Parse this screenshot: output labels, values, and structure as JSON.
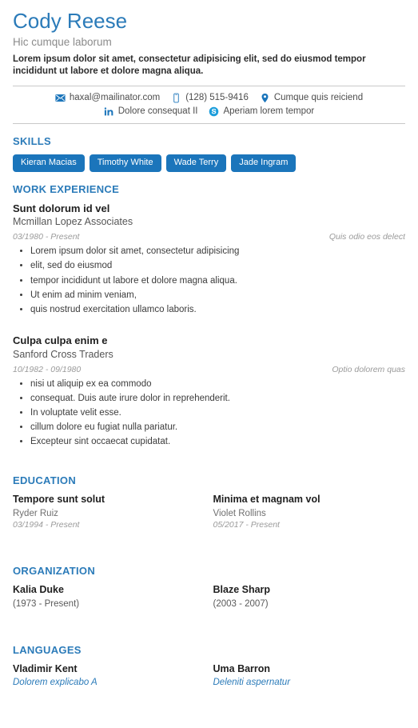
{
  "header": {
    "name": "Cody Reese",
    "subtitle": "Hic cumque laborum",
    "summary": "Lorem ipsum dolor sit amet, consectetur adipisicing elit, sed do eiusmod tempor incididunt ut labore et dolore magna aliqua."
  },
  "contact": {
    "row1": [
      {
        "icon": "envelope-icon",
        "text": "haxal@mailinator.com"
      },
      {
        "icon": "mobile-phone-icon",
        "text": "(128) 515-9416"
      },
      {
        "icon": "location-pin-icon",
        "text": "Cumque quis reiciend"
      }
    ],
    "row2": [
      {
        "icon": "linkedin-icon",
        "text": "Dolore consequat II"
      },
      {
        "icon": "skype-icon",
        "text": "Aperiam lorem tempor"
      }
    ]
  },
  "sections": {
    "skills": {
      "title": "SKILLS",
      "badges": [
        "Kieran Macias",
        "Timothy White",
        "Wade Terry",
        "Jade Ingram"
      ]
    },
    "work": {
      "title": "WORK EXPERIENCE",
      "jobs": [
        {
          "title": "Sunt dolorum id vel",
          "company": "Mcmillan Lopez Associates",
          "dates": "03/1980 - Present",
          "location": "Quis odio eos delect",
          "bullets": [
            "Lorem ipsum dolor sit amet, consectetur adipisicing",
            "elit, sed do eiusmod",
            "tempor incididunt ut labore et dolore magna aliqua.",
            "Ut enim ad minim veniam,",
            "quis nostrud exercitation ullamco laboris."
          ]
        },
        {
          "title": "Culpa culpa enim e",
          "company": "Sanford Cross Traders",
          "dates": "10/1982 - 09/1980",
          "location": "Optio dolorem quas",
          "bullets": [
            "nisi ut aliquip ex ea commodo",
            "consequat. Duis aute irure dolor in reprehenderit.",
            "In voluptate velit esse.",
            "cillum dolore eu fugiat nulla pariatur.",
            "Excepteur sint occaecat cupidatat."
          ]
        }
      ]
    },
    "education": {
      "title": "EDUCATION",
      "entries": [
        {
          "title": "Tempore sunt solut",
          "sub": "Ryder Ruiz",
          "date": "03/1994 - Present"
        },
        {
          "title": "Minima et magnam vol",
          "sub": "Violet Rollins",
          "date": "05/2017 - Present"
        }
      ]
    },
    "organization": {
      "title": "ORGANIZATION",
      "entries": [
        {
          "title": "Kalia Duke",
          "sub": "(1973 - Present)"
        },
        {
          "title": "Blaze Sharp",
          "sub": "(2003 - 2007)"
        }
      ]
    },
    "languages": {
      "title": "LANGUAGES",
      "entries": [
        {
          "title": "Vladimir Kent",
          "sub": "Dolorem explicabo A"
        },
        {
          "title": "Uma Barron",
          "sub": "Deleniti aspernatur"
        }
      ]
    }
  },
  "colors": {
    "accent": "#2b7bb9",
    "badge": "#1b75bb",
    "text": "#333333",
    "muted": "#9a9a9a"
  }
}
